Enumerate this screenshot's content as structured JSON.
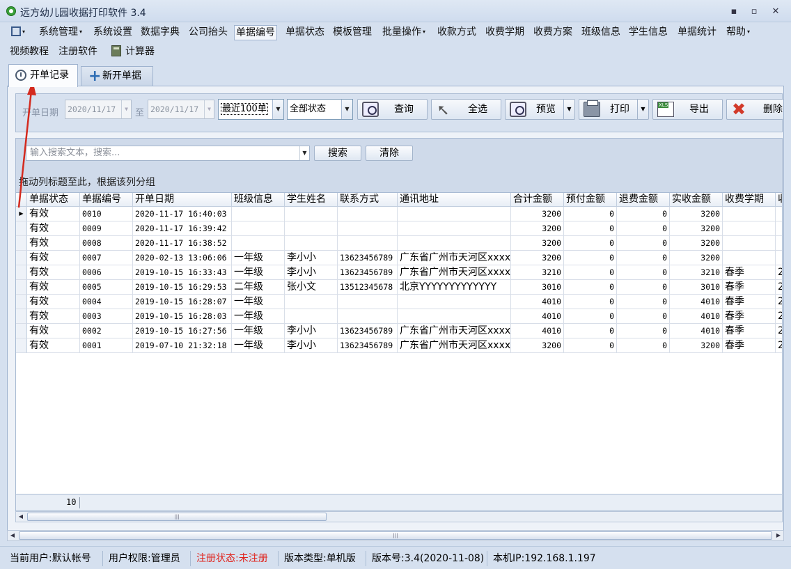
{
  "window": {
    "title": "远方幼儿园收据打印软件 3.4",
    "minimize": "▪",
    "maximize": "▫",
    "close": "✕"
  },
  "menu": {
    "row1": [
      "系统管理",
      "系统设置",
      "数据字典",
      "公司抬头",
      "单据编号",
      "单据状态",
      "模板管理",
      "批量操作",
      "收款方式",
      "收费学期",
      "收费方案",
      "班级信息",
      "学生信息",
      "单据统计",
      "帮助"
    ],
    "row2": [
      "视频教程",
      "注册软件",
      "计算器"
    ]
  },
  "tabs": {
    "records": "开单记录",
    "new_receipt": "新开单据"
  },
  "toolbar": {
    "date_label": "开单日期",
    "date_from": "2020/11/17",
    "to_label": "至",
    "date_to": "2020/11/17",
    "recent_filter": "最近100单",
    "status_filter": "全部状态",
    "query": "查询",
    "select_all": "全选",
    "preview": "预览",
    "print": "打印",
    "export": "导出",
    "delete": "删除"
  },
  "search": {
    "placeholder": "输入搜索文本，搜索...",
    "search_button": "搜索",
    "clear_button": "清除"
  },
  "group_hint": "拖动列标题至此，根据该列分组",
  "grid": {
    "columns": [
      "单据状态",
      "单据编号",
      "开单日期",
      "班级信息",
      "学生姓名",
      "联系方式",
      "通讯地址",
      "合计金额",
      "预付金额",
      "退费金额",
      "实收金额",
      "收费学期",
      "收"
    ],
    "rows": [
      [
        "有效",
        "0010",
        "2020-11-17 16:40:03",
        "",
        "",
        "",
        "",
        "3200",
        "0",
        "0",
        "3200",
        "",
        ""
      ],
      [
        "有效",
        "0009",
        "2020-11-17 16:39:42",
        "",
        "",
        "",
        "",
        "3200",
        "0",
        "0",
        "3200",
        "",
        ""
      ],
      [
        "有效",
        "0008",
        "2020-11-17 16:38:52",
        "",
        "",
        "",
        "",
        "3200",
        "0",
        "0",
        "3200",
        "",
        ""
      ],
      [
        "有效",
        "0007",
        "2020-02-13 13:06:06",
        "一年级",
        "李小小",
        "13623456789",
        "广东省广州市天河区xxxx",
        "3200",
        "0",
        "0",
        "3200",
        "",
        ""
      ],
      [
        "有效",
        "0006",
        "2019-10-15 16:33:43",
        "一年级",
        "李小小",
        "13623456789",
        "广东省广州市天河区xxxx",
        "3210",
        "0",
        "0",
        "3210",
        "春季",
        "2"
      ],
      [
        "有效",
        "0005",
        "2019-10-15 16:29:53",
        "二年级",
        "张小文",
        "13512345678",
        "北京YYYYYYYYYYYYY",
        "3010",
        "0",
        "0",
        "3010",
        "春季",
        "2"
      ],
      [
        "有效",
        "0004",
        "2019-10-15 16:28:07",
        "一年级",
        "",
        "",
        "",
        "4010",
        "0",
        "0",
        "4010",
        "春季",
        "2"
      ],
      [
        "有效",
        "0003",
        "2019-10-15 16:28:03",
        "一年级",
        "",
        "",
        "",
        "4010",
        "0",
        "0",
        "4010",
        "春季",
        "2"
      ],
      [
        "有效",
        "0002",
        "2019-10-15 16:27:56",
        "一年级",
        "李小小",
        "13623456789",
        "广东省广州市天河区xxxx",
        "4010",
        "0",
        "0",
        "4010",
        "春季",
        "2"
      ],
      [
        "有效",
        "0001",
        "2019-07-10 21:32:18",
        "一年级",
        "李小小",
        "13623456789",
        "广东省广州市天河区xxxx",
        "3200",
        "0",
        "0",
        "3200",
        "春季",
        "2"
      ]
    ],
    "row_count": "10"
  },
  "status": {
    "user": "当前用户:默认帐号",
    "permission": "用户权限:管理员",
    "registration": "注册状态:未注册",
    "edition": "版本类型:单机版",
    "version": "版本号:3.4(2020-11-08)",
    "ip": "本机IP:192.168.1.197"
  },
  "colors": {
    "accent_red": "#e0221b",
    "frame_blue": "#d5e0ef"
  }
}
